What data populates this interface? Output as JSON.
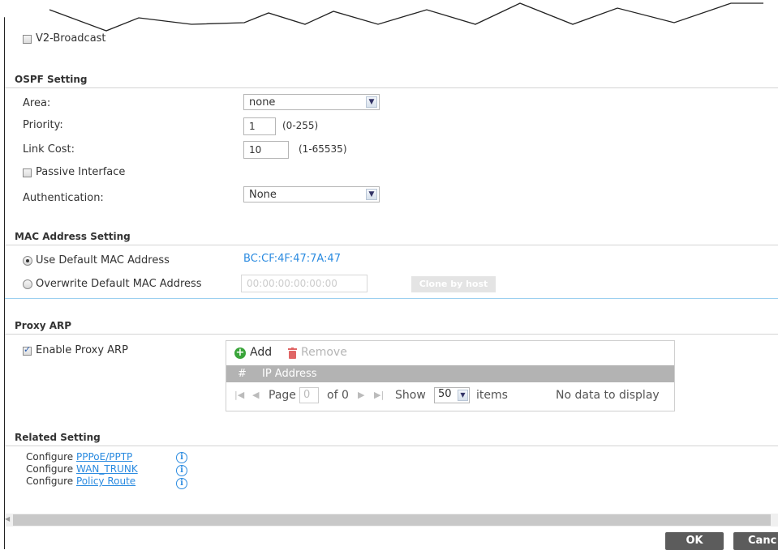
{
  "rip": {
    "v2_broadcast_label": "V2-Broadcast"
  },
  "ospf": {
    "title": "OSPF Setting",
    "area_label": "Area:",
    "area_value": "none",
    "priority_label": "Priority:",
    "priority_value": "1",
    "priority_range": "(0-255)",
    "link_cost_label": "Link Cost:",
    "link_cost_value": "10",
    "link_cost_range": "(1-65535)",
    "passive_label": "Passive Interface",
    "auth_label": "Authentication:",
    "auth_value": "None"
  },
  "mac": {
    "title": "MAC Address Setting",
    "use_default_label": "Use Default MAC Address",
    "default_mac": "BC:CF:4F:47:7A:47",
    "overwrite_label": "Overwrite Default MAC Address",
    "overwrite_placeholder": "00:00:00:00:00:00",
    "clone_label": "Clone by host"
  },
  "proxy_arp": {
    "title": "Proxy ARP",
    "enable_label": "Enable Proxy ARP",
    "add_label": "Add",
    "remove_label": "Remove",
    "col_num": "#",
    "col_ip": "IP Address",
    "page_label": "Page",
    "page_value": "0",
    "of_label": "of 0",
    "show_label": "Show",
    "show_value": "50",
    "items_label": "items",
    "no_data": "No data to display"
  },
  "related": {
    "title": "Related Setting",
    "configure": "Configure",
    "link1": "PPPoE/PPTP",
    "link2": "WAN_TRUNK",
    "link3": "Policy Route"
  },
  "footer": {
    "ok": "OK",
    "cancel": "Canc"
  },
  "colors": {
    "accent": "#2b8be0",
    "add_green": "#3aa53a",
    "remove_red": "#e06666",
    "table_header": "#b3b3b3"
  }
}
